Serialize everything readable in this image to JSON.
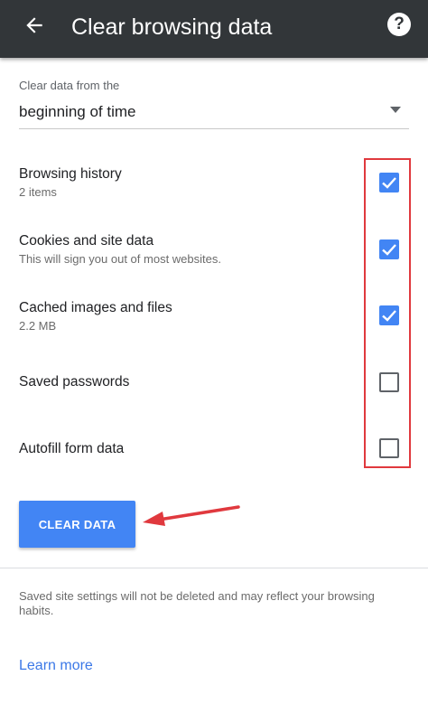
{
  "appbar": {
    "title": "Clear browsing data",
    "back_icon": "arrow-back-icon",
    "help_icon": "help-icon",
    "help_glyph": "?",
    "background": "#323639"
  },
  "time_range": {
    "caption": "Clear data from the",
    "value": "beginning of time"
  },
  "options": [
    {
      "title": "Browsing history",
      "subtitle": "2 items",
      "checked": true
    },
    {
      "title": "Cookies and site data",
      "subtitle": "This will sign you out of most websites.",
      "checked": true
    },
    {
      "title": "Cached images and files",
      "subtitle": "2.2 MB",
      "checked": true
    },
    {
      "title": "Saved passwords",
      "subtitle": "",
      "checked": false
    },
    {
      "title": "Autofill form data",
      "subtitle": "",
      "checked": false
    }
  ],
  "clear_button": {
    "label": "CLEAR DATA"
  },
  "footnote": "Saved site settings will not be deleted and may reflect your browsing habits.",
  "learn_more": "Learn more",
  "colors": {
    "accent": "#4285f4",
    "annotation": "#e0393e",
    "link": "#3b78e7"
  }
}
